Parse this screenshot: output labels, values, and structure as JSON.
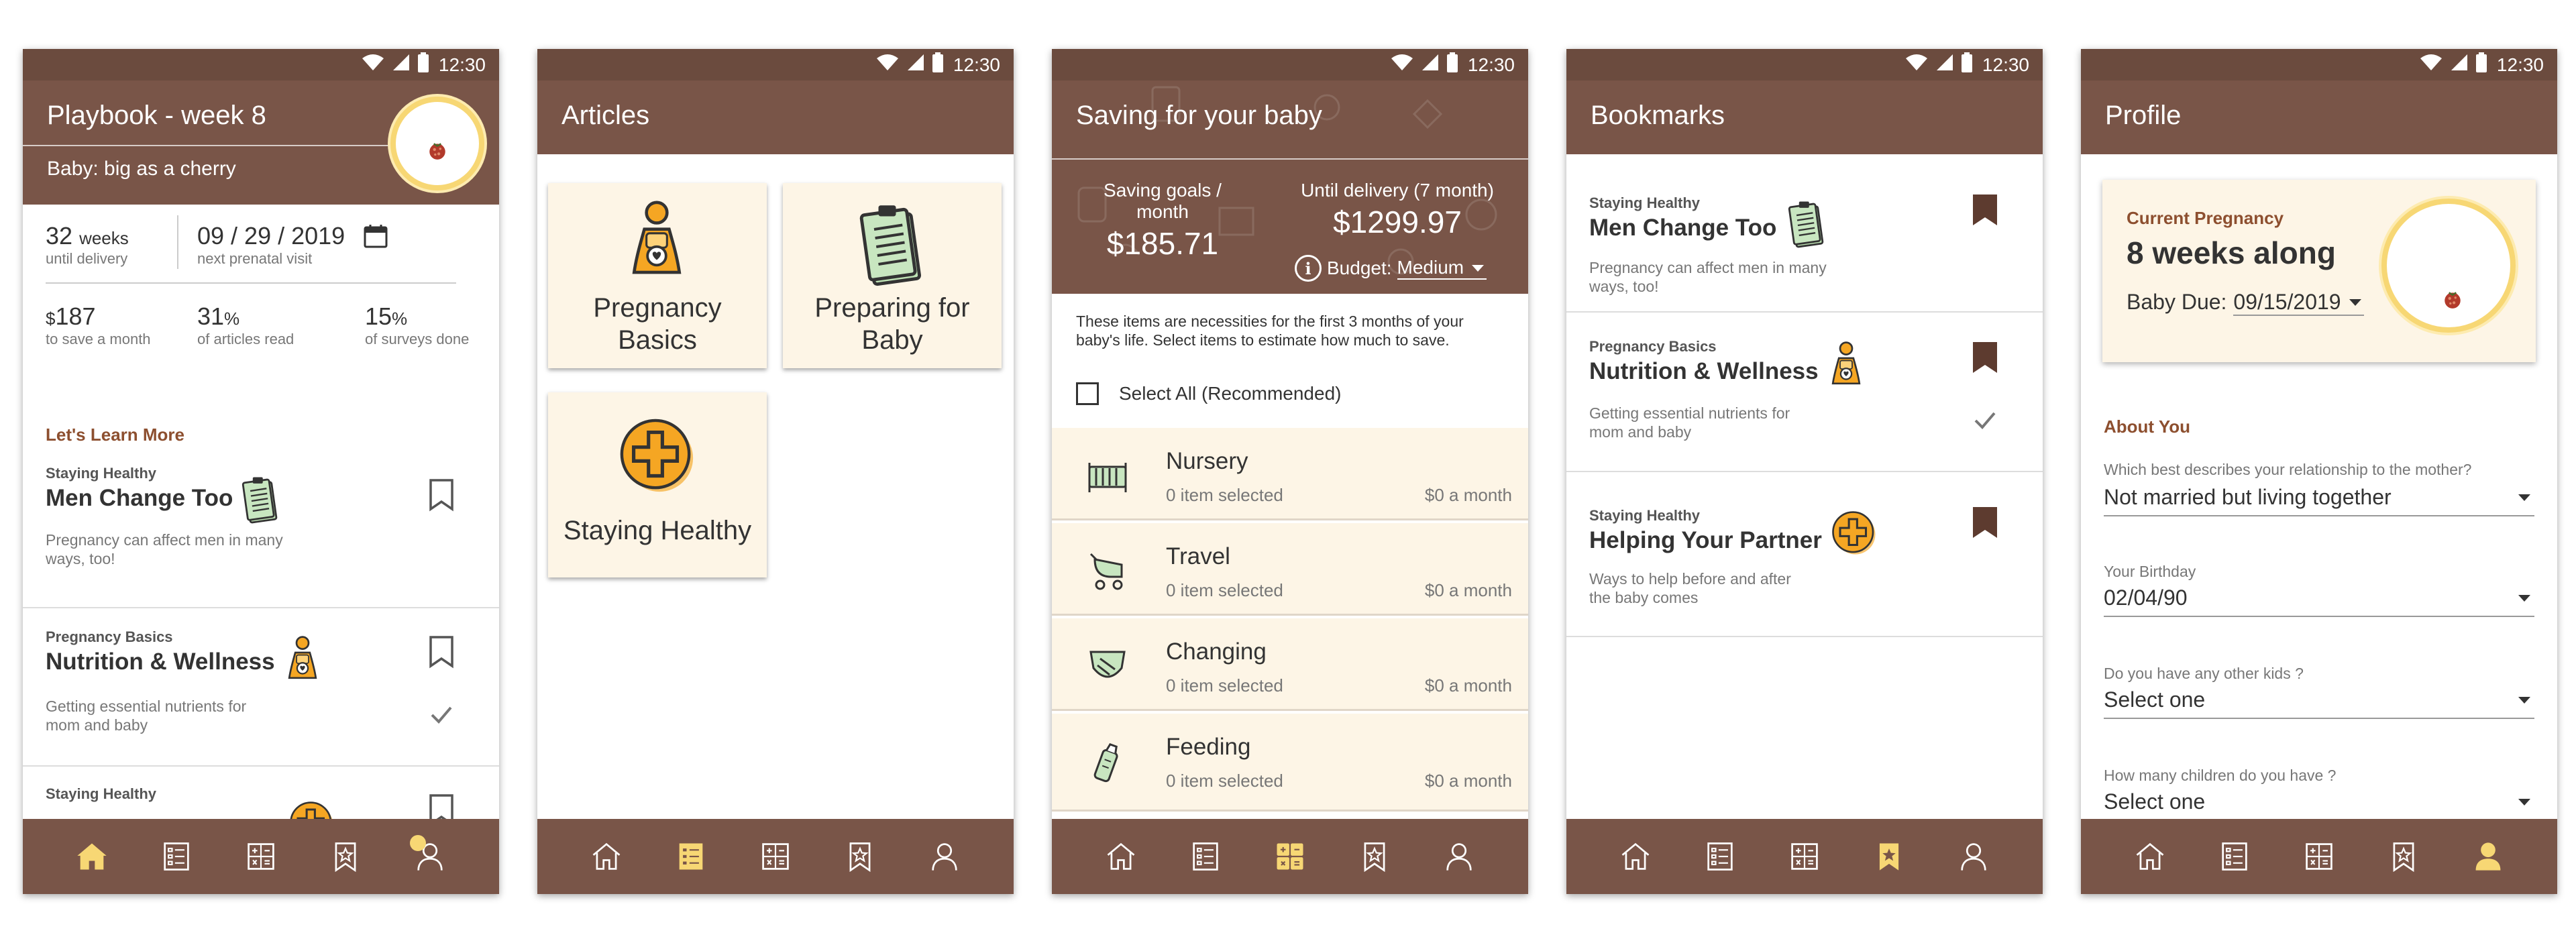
{
  "status": {
    "time": "12:30"
  },
  "colors": {
    "brown": "#795548",
    "cream": "#fdf5e6",
    "yellow": "#f7d774",
    "orange": "#f5a623",
    "accent_text": "#8d4f2f"
  },
  "playbook": {
    "title": "Playbook - week 8",
    "subtitle": "Baby: big as a cherry",
    "stats": {
      "weeks_value": "32",
      "weeks_unit": "weeks",
      "weeks_caption": "until delivery",
      "visit_date": "09 / 29 / 2019",
      "visit_caption": "next prenatal visit",
      "save_currency": "$",
      "save_value": "187",
      "save_caption": "to save a month",
      "articles_value": "31",
      "articles_unit": "%",
      "articles_caption": "of articles read",
      "surveys_value": "15",
      "surveys_unit": "%",
      "surveys_caption": "of surveys done"
    },
    "section_label": "Let's Learn More",
    "cards": [
      {
        "kicker": "Staying Healthy",
        "title": "Men Change Too",
        "desc_line1": "Pregnancy can affect men in many",
        "desc_line2": "ways, too!"
      },
      {
        "kicker": "Pregnancy Basics",
        "title": "Nutrition & Wellness",
        "desc_line1": "Getting essential nutrients for",
        "desc_line2": "mom and baby"
      },
      {
        "kicker": "Staying Healthy"
      }
    ]
  },
  "articles": {
    "title": "Articles",
    "tiles": [
      {
        "line1": "Pregnancy",
        "line2": "Basics",
        "icon": "mother-icon"
      },
      {
        "line1": "Preparing for",
        "line2": "Baby",
        "icon": "clipboard-icon"
      },
      {
        "line1": "Staying Healthy",
        "icon": "medical-cross-icon"
      }
    ]
  },
  "saving": {
    "title": "Saving for your baby",
    "goal_label": "Saving goals / month",
    "goal_value": "$185.71",
    "until_label": "Until delivery (7 month)",
    "until_value": "$1299.97",
    "budget_label": "Budget:",
    "budget_value": "Medium",
    "intro_line1": "These items are necessities for the first 3 months of your",
    "intro_line2": "baby's life. Select items to estimate how much to save.",
    "select_all": "Select All (Recommended)",
    "items": [
      {
        "name": "Nursery",
        "selected": "0 item selected",
        "amount": "$0 a month",
        "icon": "crib-icon"
      },
      {
        "name": "Travel",
        "selected": "0 item selected",
        "amount": "$0 a month",
        "icon": "stroller-icon"
      },
      {
        "name": "Changing",
        "selected": "0 item selected",
        "amount": "$0 a month",
        "icon": "diaper-icon"
      },
      {
        "name": "Feeding",
        "selected": "0 item selected",
        "amount": "$0 a month",
        "icon": "bottle-icon"
      }
    ]
  },
  "bookmarks": {
    "title": "Bookmarks",
    "items": [
      {
        "kicker": "Staying Healthy",
        "title": "Men Change Too",
        "desc_line1": "Pregnancy can affect men in many",
        "desc_line2": "ways, too!"
      },
      {
        "kicker": "Pregnancy Basics",
        "title": "Nutrition & Wellness",
        "desc_line1": "Getting essential nutrients for",
        "desc_line2": "mom and baby"
      },
      {
        "kicker": "Staying Healthy",
        "title": "Helping Your Partner",
        "desc_line1": "Ways to help before and after",
        "desc_line2": "the baby comes"
      }
    ]
  },
  "profile": {
    "title": "Profile",
    "card_label": "Current Pregnancy",
    "weeks_along": "8 weeks along",
    "due_label": "Baby Due:",
    "due_value": "09/15/2019",
    "about_label": "About You",
    "fields": [
      {
        "label": "Which best describes your relationship to the mother?",
        "value": "Not married but living together"
      },
      {
        "label": "Your Birthday",
        "value": "02/04/90"
      },
      {
        "label": "Do you have any other kids ?",
        "value": "Select one"
      },
      {
        "label": "How many children do you have ?",
        "value": "Select one"
      }
    ]
  }
}
